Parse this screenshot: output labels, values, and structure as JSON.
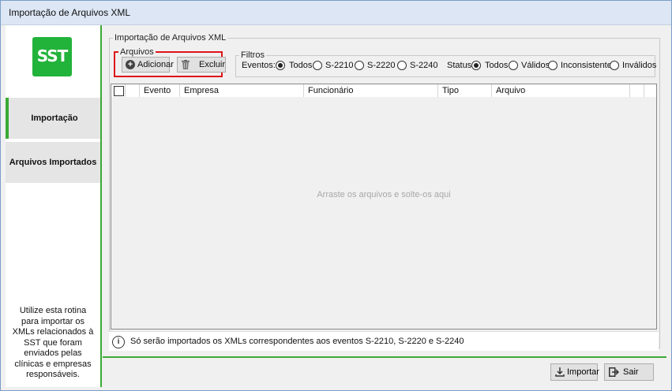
{
  "window": {
    "title": "Importação de Arquivos XML"
  },
  "logo": {
    "text": "SST",
    "color": "#22b33a"
  },
  "sidebar": {
    "items": [
      {
        "label": "Importação",
        "active": true
      },
      {
        "label": "Arquivos Importados",
        "active": false
      }
    ],
    "help_text": "Utilize esta rotina para importar os XMLs relacionados à SST que foram enviados pelas clínicas e empresas responsáveis."
  },
  "main": {
    "group_title": "Importação de Arquivos XML",
    "arquivos": {
      "legend": "Arquivos",
      "add_label": "Adicionar",
      "add_icon": "plus-circle-icon",
      "delete_label": "Excluir",
      "delete_icon": "trash-icon"
    },
    "filtros": {
      "legend": "Filtros",
      "eventos_label": "Eventos:",
      "eventos_options": [
        "Todos",
        "S-2210",
        "S-2220",
        "S-2240"
      ],
      "eventos_selected": "Todos",
      "status_label": "Status:",
      "status_options": [
        "Todos",
        "Válidos",
        "Inconsistentes",
        "Inválidos"
      ],
      "status_selected": "Todos"
    },
    "grid": {
      "columns": [
        "Evento",
        "Empresa",
        "Funcionário",
        "Tipo",
        "Arquivo"
      ],
      "rows": [],
      "empty_message": "Arraste os arquivos e solte-os aqui"
    },
    "info_text": "Só serão importados os XMLs correspondentes aos eventos S-2210, S-2220 e S-2240"
  },
  "footer": {
    "import_label": "Importar",
    "import_icon": "download-icon",
    "exit_label": "Sair",
    "exit_icon": "exit-icon"
  },
  "colors": {
    "accent": "#3aaa35",
    "highlight_border": "#e0141a"
  }
}
